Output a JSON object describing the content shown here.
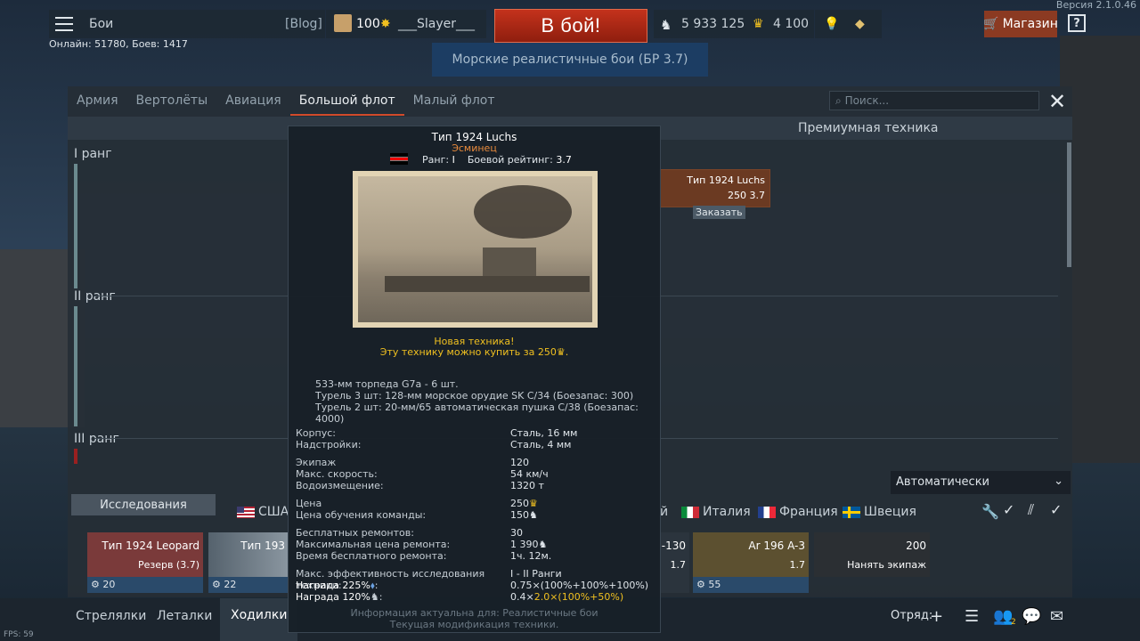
{
  "topbar": {
    "menu_label": "Бои",
    "blog_label": "[Blog]",
    "player_level": "100",
    "player_name": "___Slayer___",
    "battle_button": "В бой!",
    "silver_lions": "5 933 125",
    "golden_eagles": "4 100",
    "shop_label": "Магазин",
    "help_label": "?",
    "version": "Версия 2.1.0.46",
    "online_status": "Онлайн: 51780, Боев: 1417",
    "game_mode": "Морские реалистичные бои (БР 3.7)"
  },
  "panel": {
    "tabs": [
      {
        "label": "Армия"
      },
      {
        "label": "Вертолёты"
      },
      {
        "label": "Авиация"
      },
      {
        "label": "Большой флот"
      },
      {
        "label": "Малый флот"
      }
    ],
    "active_tab": "Большой флот",
    "search_placeholder": "Поиск...",
    "premium_header": "Премиумная техника",
    "ranks": [
      "I ранг",
      "II ранг",
      "III ранг"
    ],
    "tree_card": {
      "name": "Тип 1924 Luchs",
      "stats": "250 3.7",
      "order_label": "Заказать"
    },
    "auto_select": "Автоматически",
    "research_label": "Исследования",
    "nations": [
      "США",
      "й",
      "Италия",
      "Франция",
      "Швеция"
    ]
  },
  "crew_slots": [
    {
      "name": "Тип 1924 Leopard",
      "status": "Резерв (3.7)",
      "crew": "20"
    },
    {
      "name": "Тип 193",
      "status": "",
      "crew": "22"
    },
    {
      "name": "-130",
      "status": "1.7",
      "crew": ""
    },
    {
      "name": "Ar 196 A-3",
      "status": "1.7",
      "crew": "55"
    },
    {
      "name": "200",
      "status": "Нанять экипаж",
      "crew": ""
    }
  ],
  "bottombar": {
    "tabs": [
      {
        "label": "Стрелялки"
      },
      {
        "label": "Леталки"
      },
      {
        "label": "Ходилки"
      }
    ],
    "fps": "FPS: 59",
    "squad_label": "Отряд:",
    "contacts_count": "2"
  },
  "tooltip": {
    "title": "Тип 1924 Luchs",
    "class": "Эсминец",
    "rank_label": "Ранг:",
    "rank_value": "I",
    "br_label": "Боевой рейтинг:",
    "br_value": "3.7",
    "new_label": "Новая техника!",
    "buy_label": "Эту технику можно купить за 250",
    "armament": [
      "533-мм торпеда G7a - 6 шт.",
      "Турель 3 шт: 128-мм морское орудие SK C/34 (Боезапас: 300)",
      "Турель 2 шт: 20-мм/65 автоматическая пушка C/38 (Боезапас: 4000)"
    ],
    "stats": {
      "hull_label": "Корпус:",
      "hull_value": "Сталь, 16 мм",
      "super_label": "Надстройки:",
      "super_value": "Сталь, 4 мм",
      "crew_label": "Экипаж",
      "crew_value": "120",
      "speed_label": "Макс. скорость:",
      "speed_value": "54 км/ч",
      "disp_label": "Водоизмещение:",
      "disp_value": "1320 т",
      "price_label": "Цена",
      "price_value": "250",
      "training_label": "Цена обучения команды:",
      "training_value": "150",
      "free_repairs_label": "Бесплатных ремонтов:",
      "free_repairs_value": "30",
      "max_repair_label": "Максимальная цена ремонта:",
      "max_repair_value": "1 390",
      "free_repair_time_label": "Время бесплатного ремонта:",
      "free_repair_time_value": "1ч. 12м.",
      "research_eff_label": "Макс. эффективность исследования техники:",
      "research_eff_value": "I - II Ранги",
      "rp_reward_label": "Награда 225%",
      "rp_reward_value": "0.75×(100%+100%+100%)",
      "sl_reward_label": "Награда 120%",
      "sl_reward_value_a": "0.4×",
      "sl_reward_value_b": "2.0",
      "sl_reward_value_c": "×(100%+50%)"
    },
    "footer_line1": "Информация актуальна для: Реалистичные бои",
    "footer_line2": "Текущая модификация техники."
  }
}
